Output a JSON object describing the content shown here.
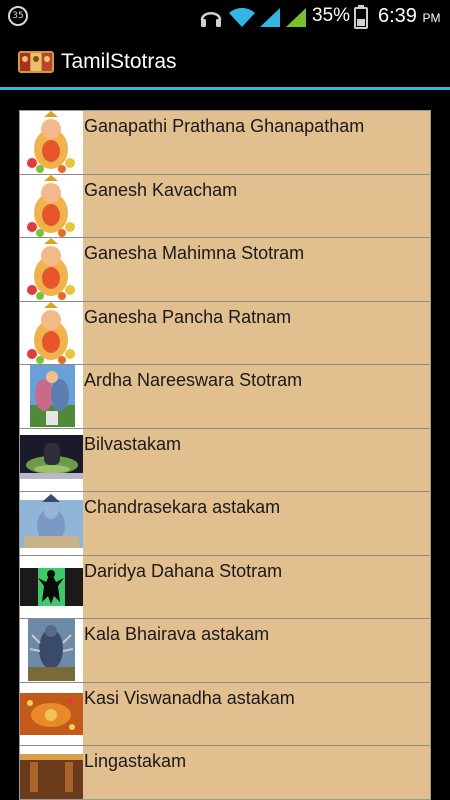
{
  "status_bar": {
    "notification_count": "35",
    "battery_percent": "35%",
    "time": "6:39",
    "ampm": "PM",
    "icons": [
      "headset-icon",
      "wifi-icon",
      "cell-signal-icon",
      "cell-signal-icon",
      "battery-icon"
    ]
  },
  "app": {
    "title": "TamilStotras",
    "accent_color": "#33b5e5",
    "item_bg_color": "#e2bf8f"
  },
  "list": {
    "items": [
      {
        "label": "Ganapathi Prathana Ghanapatham",
        "thumb": "ganesha-image"
      },
      {
        "label": "Ganesh Kavacham",
        "thumb": "ganesha-image"
      },
      {
        "label": "Ganesha Mahimna Stotram",
        "thumb": "ganesha-image"
      },
      {
        "label": "Ganesha Pancha Ratnam",
        "thumb": "ganesha-image"
      },
      {
        "label": "Ardha Nareeswara Stotram",
        "thumb": "ardhanareeswara-image"
      },
      {
        "label": "Bilvastakam",
        "thumb": "shiva-lingam-image"
      },
      {
        "label": "Chandrasekara astakam",
        "thumb": "shiva-image"
      },
      {
        "label": "Daridya Dahana Stotram",
        "thumb": "nataraja-silhouette-image"
      },
      {
        "label": "Kala Bhairava astakam",
        "thumb": "kala-bhairava-image"
      },
      {
        "label": "Kasi Viswanadha astakam",
        "thumb": "kasi-temple-image"
      },
      {
        "label": "Lingastakam",
        "thumb": "temple-interior-image"
      }
    ]
  }
}
